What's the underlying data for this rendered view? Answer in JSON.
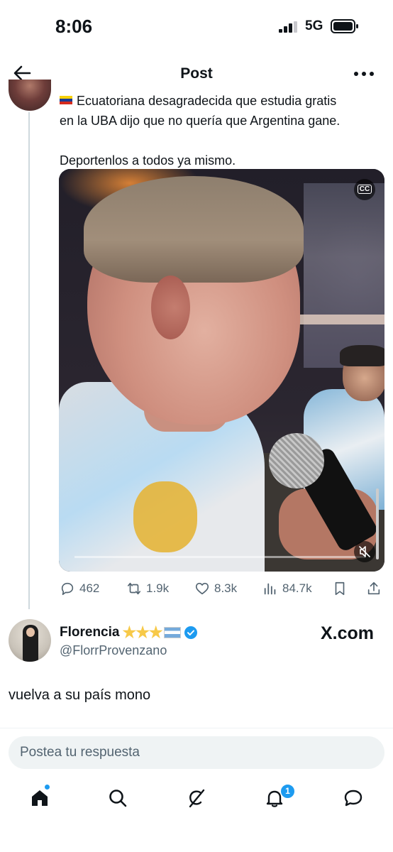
{
  "status_bar": {
    "time": "8:06",
    "network": "5G"
  },
  "header": {
    "title": "Post"
  },
  "quoted_tweet": {
    "line1": "Ecuatoriana desagradecida que estudia gratis",
    "line2": "en la UBA dijo que no quería que Argentina gane.",
    "line3": "Deportenlos a todos ya mismo.",
    "media": {
      "type": "video",
      "cc_label": "CC"
    },
    "stats": {
      "replies": "462",
      "reposts": "1.9k",
      "likes": "8.3k",
      "views": "84.7k"
    }
  },
  "reply": {
    "name": "Florencia",
    "handle": "@FlorrProvenzano",
    "watermark": "X.com",
    "text": "vuelva a su país mono"
  },
  "composer": {
    "placeholder": "Postea tu respuesta"
  },
  "bottom_nav": {
    "items": [
      "home-icon",
      "search-icon",
      "grok-icon",
      "notifications-icon",
      "messages-icon"
    ],
    "notification_count": "1"
  },
  "colors": {
    "accent": "#1d9bf0",
    "text": "#0f1419",
    "secondary": "#536471"
  }
}
